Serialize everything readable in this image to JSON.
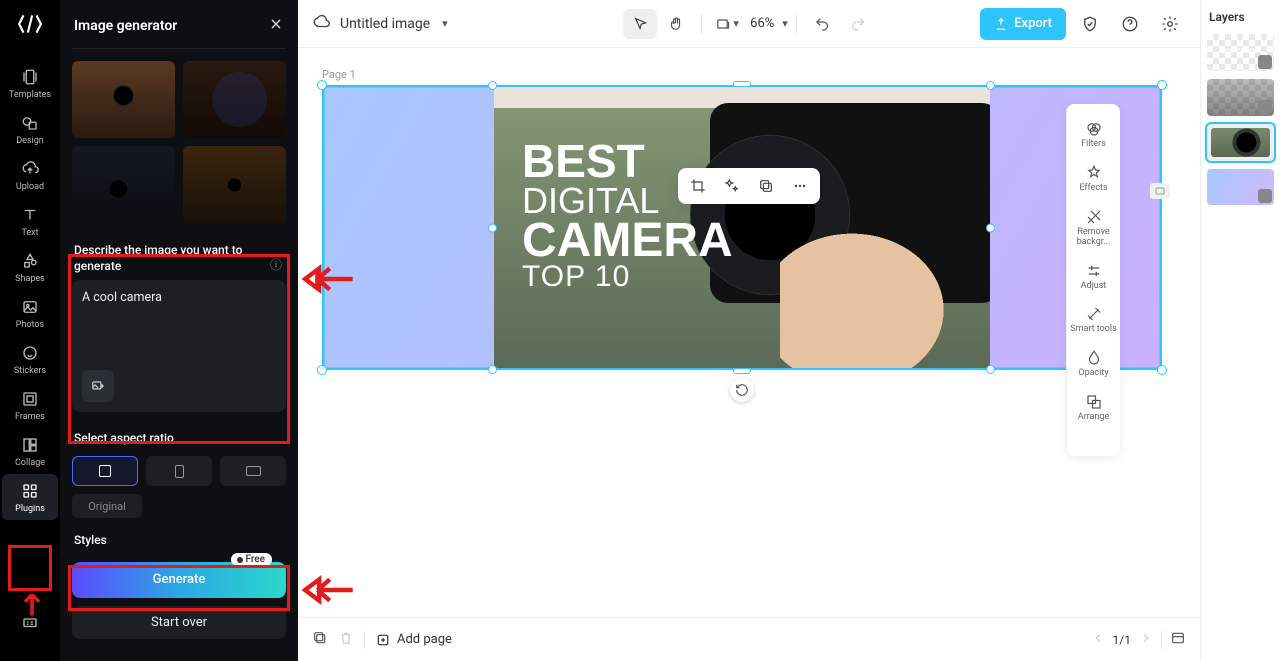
{
  "rail": {
    "items": [
      {
        "key": "templates",
        "label": "Templates"
      },
      {
        "key": "design",
        "label": "Design"
      },
      {
        "key": "upload",
        "label": "Upload"
      },
      {
        "key": "text",
        "label": "Text"
      },
      {
        "key": "shapes",
        "label": "Shapes"
      },
      {
        "key": "photos",
        "label": "Photos"
      },
      {
        "key": "stickers",
        "label": "Stickers"
      },
      {
        "key": "frames",
        "label": "Frames"
      },
      {
        "key": "collage",
        "label": "Collage"
      },
      {
        "key": "plugins",
        "label": "Plugins"
      }
    ]
  },
  "panel": {
    "title": "Image generator",
    "describe_label": "Describe the image you want to generate",
    "prompt_value": "A cool camera",
    "aspect_label": "Select aspect ratio",
    "original_label": "Original",
    "styles_label": "Styles",
    "generate_label": "Generate",
    "generate_badge": "Free",
    "startover_label": "Start over"
  },
  "topbar": {
    "doc_title": "Untitled image",
    "zoom": "66%",
    "export": "Export"
  },
  "canvas": {
    "page_label": "Page 1",
    "slide_text": {
      "l1": "BEST",
      "l2": "DIGITAL",
      "l3": "CAMERA",
      "l4": "TOP 10"
    }
  },
  "inspector": {
    "items": [
      {
        "key": "filters",
        "label": "Filters"
      },
      {
        "key": "effects",
        "label": "Effects"
      },
      {
        "key": "removebg",
        "label": "Remove backgr..."
      },
      {
        "key": "adjust",
        "label": "Adjust"
      },
      {
        "key": "smart",
        "label": "Smart tools"
      },
      {
        "key": "opacity",
        "label": "Opacity"
      },
      {
        "key": "arrange",
        "label": "Arrange"
      }
    ]
  },
  "layers": {
    "title": "Layers"
  },
  "bottombar": {
    "addpage": "Add page",
    "page_indicator": "1/1"
  }
}
